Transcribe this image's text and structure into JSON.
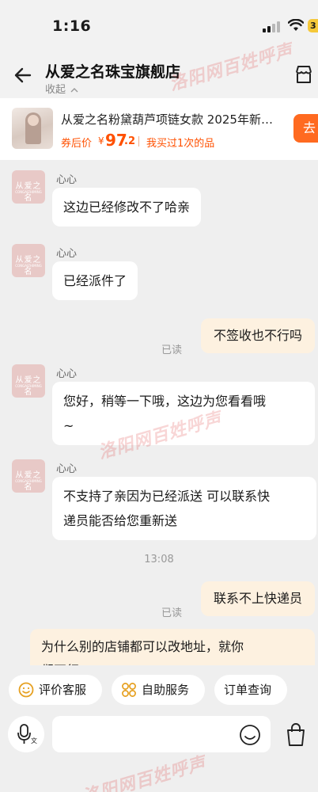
{
  "status_bar": {
    "time": "1:16",
    "battery": "3"
  },
  "header": {
    "title": "从爱之名珠宝旗舰店",
    "collapse": "收起",
    "back_icon": "back-arrow-icon",
    "shop_icon": "shop-icon"
  },
  "product": {
    "name": "从爱之名粉黛葫芦项链女款 2025年新…",
    "price_label": "券后价",
    "price_symbol": "¥",
    "price_int": "97",
    "price_dec": ".2",
    "note": "我买过1次的品",
    "go_label": "去"
  },
  "avatar": {
    "name": "从爱之名",
    "sub": "CONGAIZHIMING"
  },
  "messages": [
    {
      "from": "shop",
      "sender": "心心",
      "text": "这边已经修改不了哈亲"
    },
    {
      "from": "shop",
      "sender": "心心",
      "text": "已经派件了"
    },
    {
      "from": "me",
      "read": "已读",
      "text": "不签收也不行吗"
    },
    {
      "from": "shop",
      "sender": "心心",
      "text_line1": "您好，稍等一下哦，这边为您看看哦",
      "text_line2": "~"
    },
    {
      "from": "shop",
      "sender": "心心",
      "text_line1": "不支持了亲因为已经派送 可以联系快",
      "text_line2": "递员能否给您重新送"
    },
    {
      "time": "13:08"
    },
    {
      "from": "me",
      "read": "已读",
      "text": "联系不上快递员"
    },
    {
      "from": "me",
      "text_line1": "为什么别的店铺都可以改地址，就你",
      "text_line2": "们不行"
    }
  ],
  "quick_actions": [
    {
      "label": "评价客服",
      "icon": "smiley-icon"
    },
    {
      "label": "自助服务",
      "icon": "grid-icon"
    },
    {
      "label": "订单查询",
      "icon": ""
    }
  ],
  "input": {
    "placeholder": ""
  },
  "watermark": {
    "text": "洛阳网百姓呼声"
  },
  "colors": {
    "accent": "#ff5000",
    "go_button": "#ff6a20",
    "my_bubble": "#fdf1e0",
    "avatar": "#e8c9c7"
  }
}
